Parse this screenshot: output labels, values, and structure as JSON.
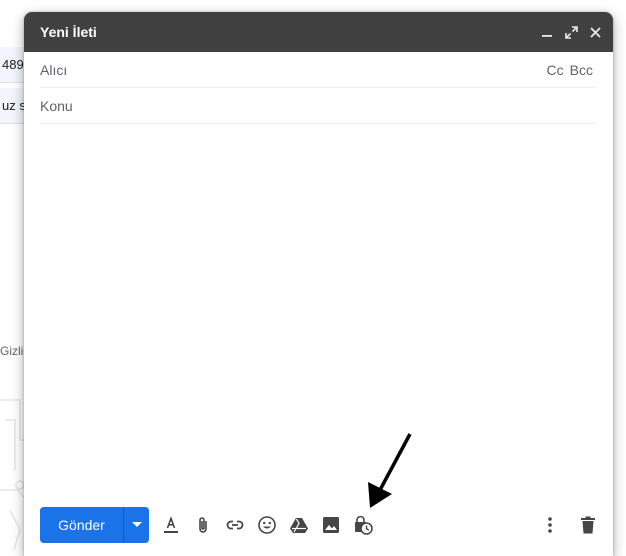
{
  "background": {
    "row1_text": "489",
    "row2_text": "uz s",
    "side_text": "Gizli"
  },
  "compose": {
    "title": "Yeni İleti",
    "header_icons": [
      "minimize-icon",
      "expand-icon",
      "close-icon"
    ],
    "to": {
      "placeholder": "Alıcı",
      "value": ""
    },
    "cc_label": "Cc",
    "bcc_label": "Bcc",
    "subject": {
      "placeholder": "Konu",
      "value": ""
    },
    "send_label": "Gönder",
    "toolbar_icons": [
      "format-text-icon",
      "attach-icon",
      "link-icon",
      "emoji-icon",
      "drive-icon",
      "image-icon",
      "confidential-mode-icon",
      "more-options-icon",
      "trash-icon"
    ]
  },
  "colors": {
    "header_bg": "#404040",
    "send_blue": "#1a73e8",
    "icon_gray": "#444746"
  }
}
